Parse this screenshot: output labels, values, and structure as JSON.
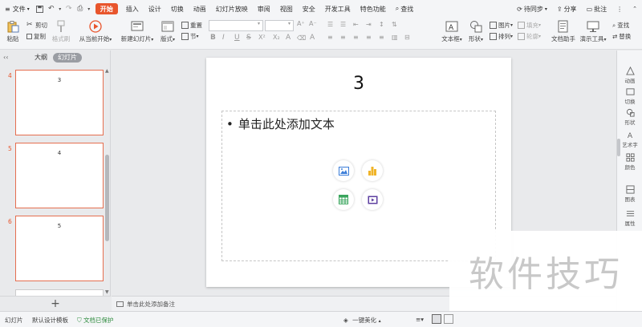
{
  "menu": {
    "file": "文件",
    "tabs": [
      "开始",
      "插入",
      "设计",
      "切换",
      "动画",
      "幻灯片放映",
      "审阅",
      "视图",
      "安全",
      "开发工具",
      "特色功能"
    ],
    "active_tab": "开始",
    "search": "查找",
    "sync": "待同步",
    "share": "分享",
    "comment": "批注"
  },
  "ribbon": {
    "paste": "粘贴",
    "cut": "剪切",
    "copy": "复制",
    "format_painter": "格式刷",
    "play_from_current": "从当前开始",
    "new_slide": "新建幻灯片",
    "layout": "版式",
    "reset": "重置",
    "section": "节",
    "text_box": "文本框",
    "shape": "形状",
    "arrange": "排列",
    "picture": "图片",
    "fill": "填充",
    "outline": "轮廓",
    "text_assistant": "文档助手",
    "presentation_tools": "演示工具",
    "find": "查找",
    "replace": "替换",
    "format_letters": [
      "B",
      "I",
      "U",
      "S",
      "X²",
      "X₂",
      "A"
    ]
  },
  "left_panel": {
    "tab_outline": "大纲",
    "tab_slides": "幻灯片",
    "slides": [
      {
        "num": "4",
        "text": "3"
      },
      {
        "num": "5",
        "text": "4"
      },
      {
        "num": "6",
        "text": "5"
      }
    ],
    "add": "+"
  },
  "slide": {
    "title": "3",
    "bullet": "•",
    "body_placeholder": "单击此处添加文本"
  },
  "notes": {
    "placeholder": "单击此处添加备注"
  },
  "right_panel": [
    "动画",
    "切换",
    "形状",
    "艺术字",
    "颜色",
    "图表",
    "属性"
  ],
  "status": {
    "slide": "幻灯片",
    "template": "默认设计模板",
    "protected": "文档已保护",
    "beautify": "一键美化"
  },
  "watermark": "软件技巧",
  "colors": {
    "accent": "#e8552c",
    "thumb_border": "#e56e4f"
  }
}
